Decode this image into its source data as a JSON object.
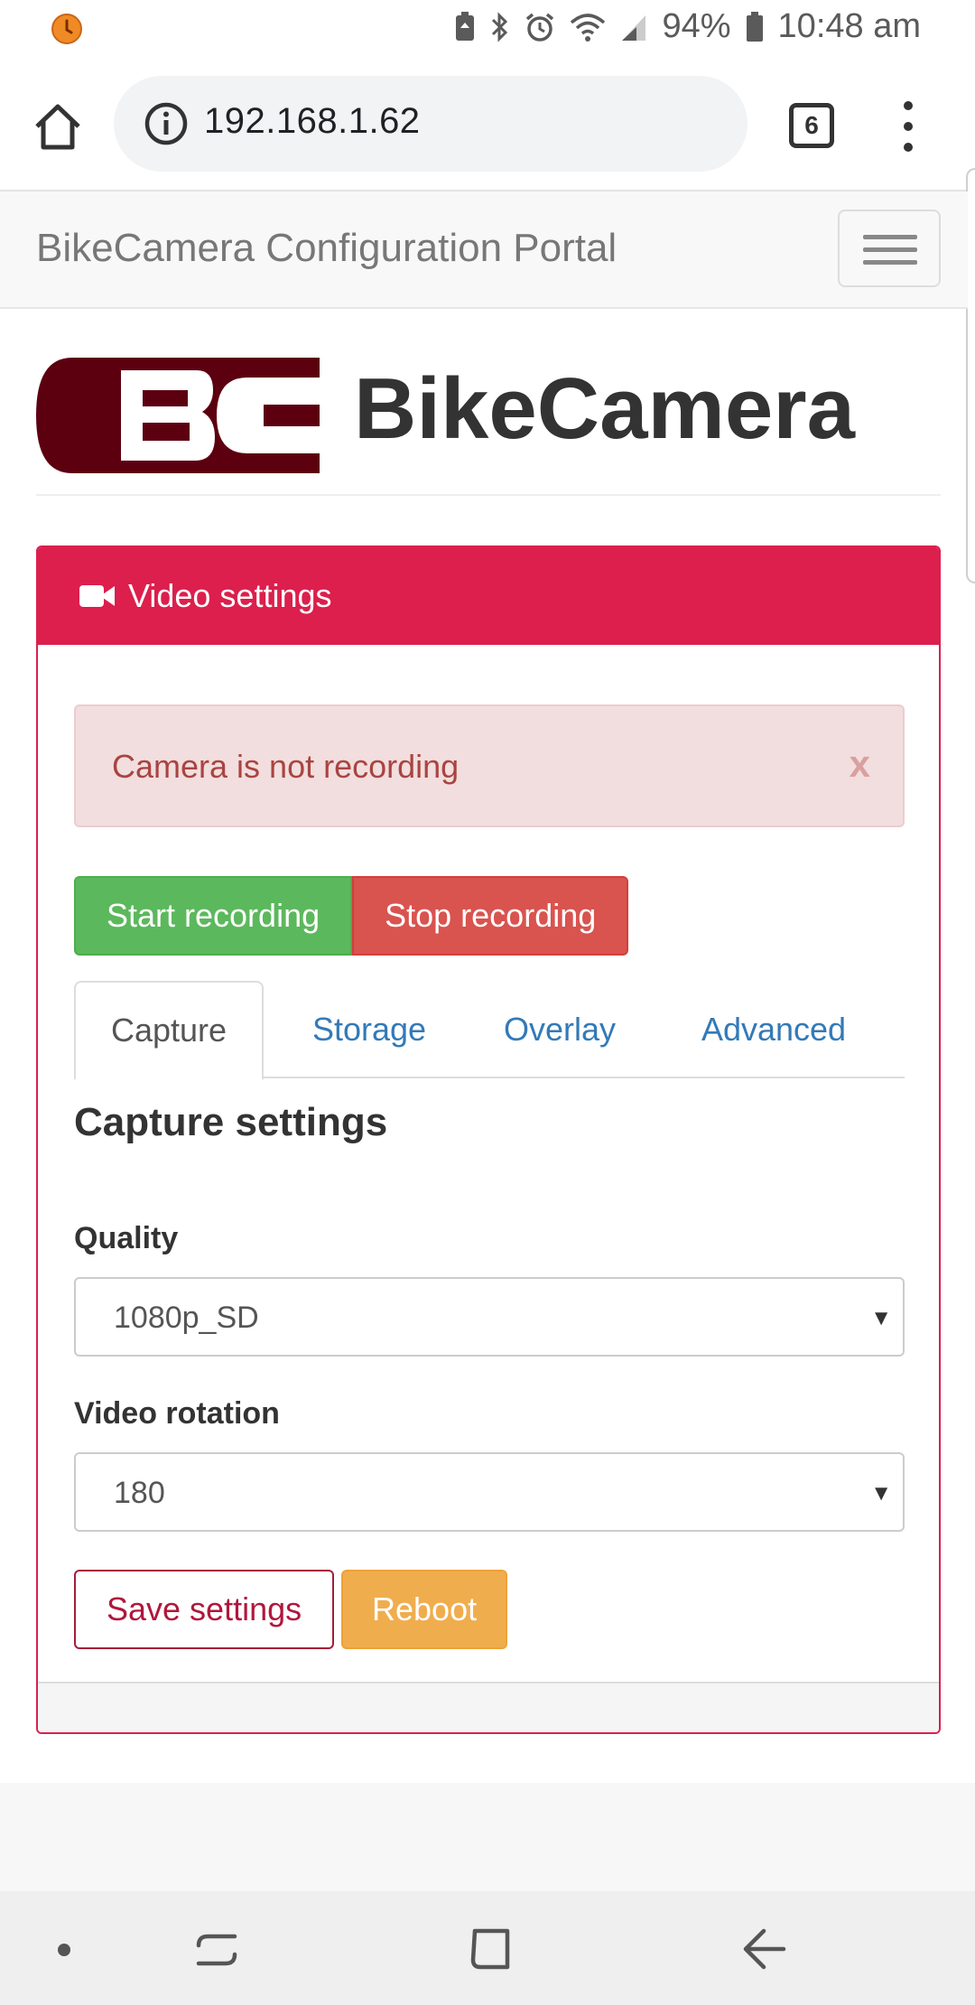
{
  "status_bar": {
    "battery": "94%",
    "time": "10:48 am"
  },
  "browser": {
    "url": "192.168.1.62",
    "tab_count": "6"
  },
  "navbar": {
    "brand": "BikeCamera Configuration Portal"
  },
  "header": {
    "logo_text": "BC",
    "title": "BikeCamera"
  },
  "panel": {
    "heading": "Video settings",
    "alert": {
      "text": "Camera is not recording",
      "close": "x"
    },
    "buttons": {
      "start": "Start recording",
      "stop": "Stop recording"
    },
    "tabs": [
      {
        "label": "Capture",
        "active": true
      },
      {
        "label": "Storage",
        "active": false
      },
      {
        "label": "Overlay",
        "active": false
      },
      {
        "label": "Advanced",
        "active": false
      }
    ],
    "section_title": "Capture settings",
    "fields": {
      "quality_label": "Quality",
      "quality_value": "1080p_SD",
      "rotation_label": "Video rotation",
      "rotation_value": "180"
    },
    "actions": {
      "save": "Save settings",
      "reboot": "Reboot"
    }
  },
  "colors": {
    "brand_red": "#dc1f4d",
    "logo_dark": "#5c0010",
    "success": "#5cb85c",
    "danger": "#d9534f",
    "warning": "#f0ad4e",
    "link": "#337ab7"
  }
}
